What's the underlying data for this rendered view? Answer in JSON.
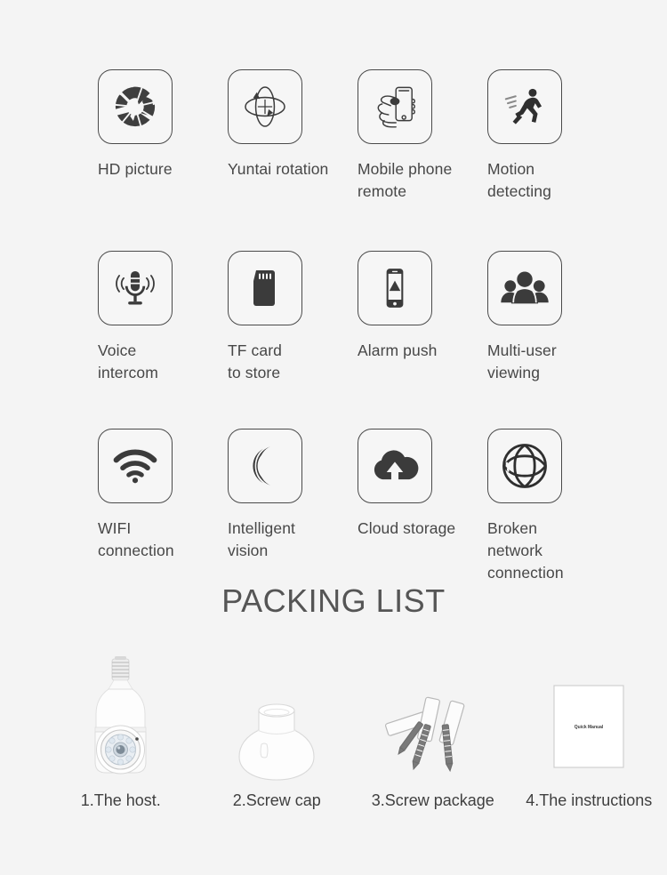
{
  "page": {
    "background_color": "#f4f4f4",
    "label_color": "#474747",
    "icon_stroke_color": "#4a4a4a",
    "icon_fill_color": "#3f3f3f"
  },
  "features": {
    "rows": [
      [
        {
          "icon": "aperture-icon",
          "label": "HD picture"
        },
        {
          "icon": "rotation-icon",
          "label": "Yuntai rotation"
        },
        {
          "icon": "hand-phone-icon",
          "label": "Mobile phone\nremote"
        },
        {
          "icon": "running-person-icon",
          "label": "Motion\ndetecting"
        }
      ],
      [
        {
          "icon": "microphone-icon",
          "label": "Voice\nintercom"
        },
        {
          "icon": "sd-card-icon",
          "label": "TF card\nto store"
        },
        {
          "icon": "phone-alert-icon",
          "label": "Alarm push"
        },
        {
          "icon": "people-group-icon",
          "label": "Multi-user\nviewing"
        }
      ],
      [
        {
          "icon": "wifi-icon",
          "label": "WIFI\nconnection"
        },
        {
          "icon": "moon-icon",
          "label": "Intelligent\nvision"
        },
        {
          "icon": "cloud-upload-icon",
          "label": "Cloud storage"
        },
        {
          "icon": "globe-icon",
          "label": "Broken\nnetwork\nconnection"
        }
      ]
    ]
  },
  "packing": {
    "title": "PACKING LIST",
    "items": [
      {
        "art": "bulb-camera-art",
        "label": "1.The host."
      },
      {
        "art": "screw-cap-art",
        "label": "2.Screw cap"
      },
      {
        "art": "screw-package-art",
        "label": "3.Screw package"
      },
      {
        "art": "manual-booklet-art",
        "label": "4.The instructions"
      }
    ],
    "manual_cover_text": "Quick Manual"
  }
}
